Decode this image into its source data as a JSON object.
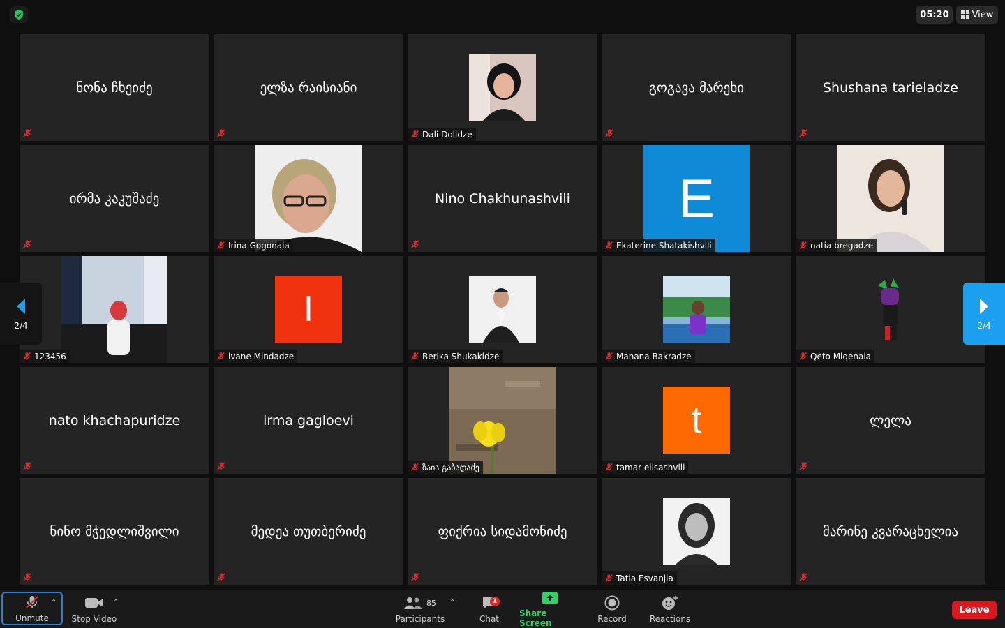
{
  "topbar": {
    "time": "05:20",
    "view_label": "View"
  },
  "pager": {
    "left_label": "2/4",
    "right_label": "2/4"
  },
  "tiles": [
    {
      "name": "ნონა ჩხეიძე"
    },
    {
      "name": "ელზა რაისიანი"
    },
    {
      "name": "Dali  Dolidze"
    },
    {
      "name": "გოგავა მარეხი"
    },
    {
      "name": "Shushana tarieladze"
    },
    {
      "name": "ირმა კაკუშაძე"
    },
    {
      "name": "Irina Gogonaia"
    },
    {
      "name": "Nino Chakhunashvili"
    },
    {
      "name": "Ekaterine Shatakishvili",
      "avatar_letter": "E"
    },
    {
      "name": "natia bregadze"
    },
    {
      "name": "123456"
    },
    {
      "name": "ivane Mindadze",
      "avatar_letter": "I"
    },
    {
      "name": "Berika Shukakidze"
    },
    {
      "name": "Manana Bakradze"
    },
    {
      "name": "Qeto Miqenaia"
    },
    {
      "name": "nato khachapuridze"
    },
    {
      "name": "irma gagloevi"
    },
    {
      "name": "ზაია გაბადაძე"
    },
    {
      "name": "tamar elisashvili",
      "avatar_letter": "t"
    },
    {
      "name": "ლელა"
    },
    {
      "name": "ნინო მჭედლიშვილი"
    },
    {
      "name": "მედეა თუთბერიძე"
    },
    {
      "name": "ფიქრია სიდამონიძე"
    },
    {
      "name": "Tatia Esvanjia"
    },
    {
      "name": "მარინე კვარაცხელია"
    }
  ],
  "toolbar": {
    "unmute": "Unmute",
    "stop_video": "Stop Video",
    "participants": "Participants",
    "participants_count": "85",
    "chat": "Chat",
    "chat_badge": "1",
    "share_screen": "Share Screen",
    "record": "Record",
    "reactions": "Reactions",
    "leave": "Leave"
  },
  "colors": {
    "tile_bg": "#242424",
    "accent_blue": "#1aa0ee",
    "leave_red": "#d9191e",
    "share_green": "#2fd36b",
    "mute_red": "#e02a2a"
  }
}
